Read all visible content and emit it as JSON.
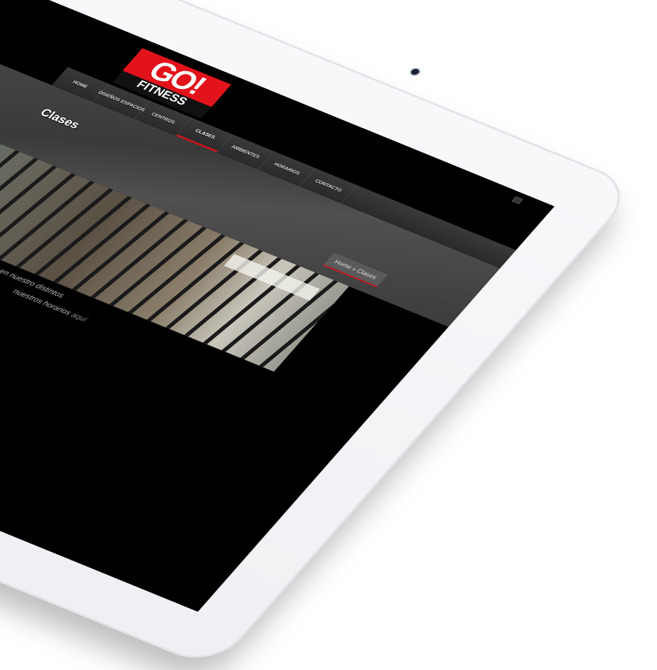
{
  "logo": {
    "brand": "GO!",
    "sub": "FITNESS"
  },
  "nav": {
    "items": [
      {
        "label": "HOME"
      },
      {
        "label": "DISEÑOS ESPACIOS"
      },
      {
        "label": "CENTROS"
      },
      {
        "label": "CLASES"
      },
      {
        "label": "AMBIENTES"
      },
      {
        "label": "HORARIOS"
      },
      {
        "label": "CONTACTO"
      }
    ],
    "active": "CLASES"
  },
  "page": {
    "title": "Clases",
    "breadcrumb": "Home » Clases"
  },
  "content": {
    "line1": "para ti! Contamos con diferentes horarios en nuestro distintos",
    "line2": "nuestros horarios",
    "link": "aquí"
  },
  "colors": {
    "accent": "#c4161c",
    "background": "#000000"
  }
}
